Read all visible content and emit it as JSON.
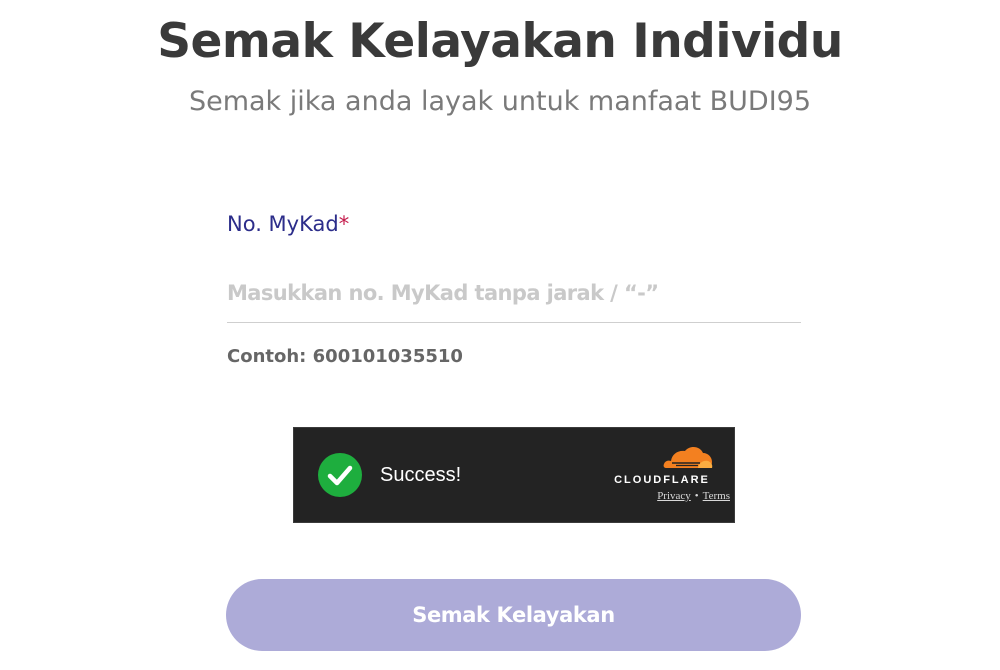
{
  "header": {
    "title": "Semak Kelayakan Individu",
    "subtitle": "Semak jika anda layak untuk manfaat BUDI95"
  },
  "form": {
    "mykad_label": "No. MyKad",
    "required_mark": "*",
    "mykad_placeholder": "Masukkan no. MyKad tanpa jarak / “-”",
    "mykad_value": "",
    "hint": "Contoh: 600101035510"
  },
  "captcha": {
    "status": "Success!",
    "brand": "CLOUDFLARE",
    "privacy_link": "Privacy",
    "separator": "•",
    "terms_link": "Terms",
    "status_icon": "check-circle-icon",
    "status_color": "#1eae3e",
    "brand_color": "#f38020",
    "background": "#232323"
  },
  "actions": {
    "submit_label": "Semak Kelayakan",
    "submit_color": "#adabd8"
  }
}
